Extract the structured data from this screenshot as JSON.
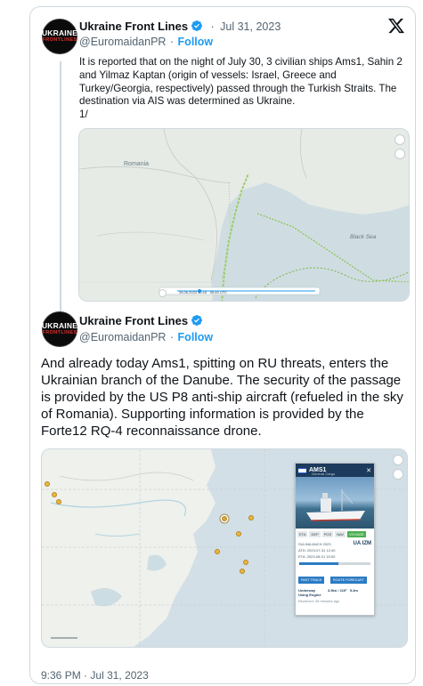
{
  "tweet1": {
    "author_name": "Ukraine Front Lines",
    "handle": "@EuromaidanPR",
    "dot": "·",
    "date": "Jul 31, 2023",
    "follow_label": "Follow",
    "text": "It is reported that on the night of July 30, 3 civilian ships Ams1, Sahin 2 and Yilmaz Kaptan (origin of vessels: Israel, Greece and Turkey/Georgia, respectively) passed through the Turkish Straits. The destination via AIS was determined as Ukraine.\n1/",
    "avatar_text_top": "UKRAINE",
    "avatar_text_bottom": "FRONTLINES",
    "map": {
      "label_country": "Romania",
      "label_sea": "Black Sea",
      "timeline_text": "26.06.2023 10:15 · 05:45 UTC"
    }
  },
  "tweet2": {
    "author_name": "Ukraine Front Lines",
    "handle": "@EuromaidanPR",
    "follow_label": "Follow",
    "text": "And already today Ams1, spitting on RU threats, enters the Ukrainian branch of the Danube. The security of the passage is provided by the US P8 anti-ship aircraft (refueled in the sky of Romania). Supporting information is provided by the Forte12 RQ-4 reconnaissance drone.",
    "avatar_text_top": "UKRAINE",
    "avatar_text_bottom": "FRONTLINES",
    "map": {
      "vessel_name": "AMS1",
      "vessel_type": "General Cargo",
      "tab_labels": [
        "ETA",
        "DEP",
        "POS",
        "NAV",
        "VOYAGE"
      ],
      "status_line": "SULINA ANCH 2023",
      "dest_port": "UA IZM",
      "atd_text": "ATD: 2023-07-31 12:40",
      "eta_text": "ETA: 2023-08-01 15:00",
      "btn_past_track": "PAST TRACK",
      "btn_route": "ROUTE FORECAST",
      "nav_status": "Underway Using Engine",
      "speed_course": "3.5kn / 219°",
      "draught": "5.3m",
      "received_text": "Received: 28 minutes ago"
    }
  },
  "footer": {
    "time": "9:36 PM",
    "dot": "·",
    "date": "Jul 31, 2023"
  },
  "colors": {
    "verified_blue": "#1d9bf0",
    "follow_blue": "#1d9bf0",
    "muted_text": "#536471",
    "border": "#cfd9de",
    "ais_route_green": "#7cb342",
    "vessel_marker_yellow": "#e8b83a"
  },
  "icons": {
    "verified": "verified-badge-icon",
    "x_logo": "x-logo-icon",
    "vessel_flag": "israel-flag-icon"
  }
}
